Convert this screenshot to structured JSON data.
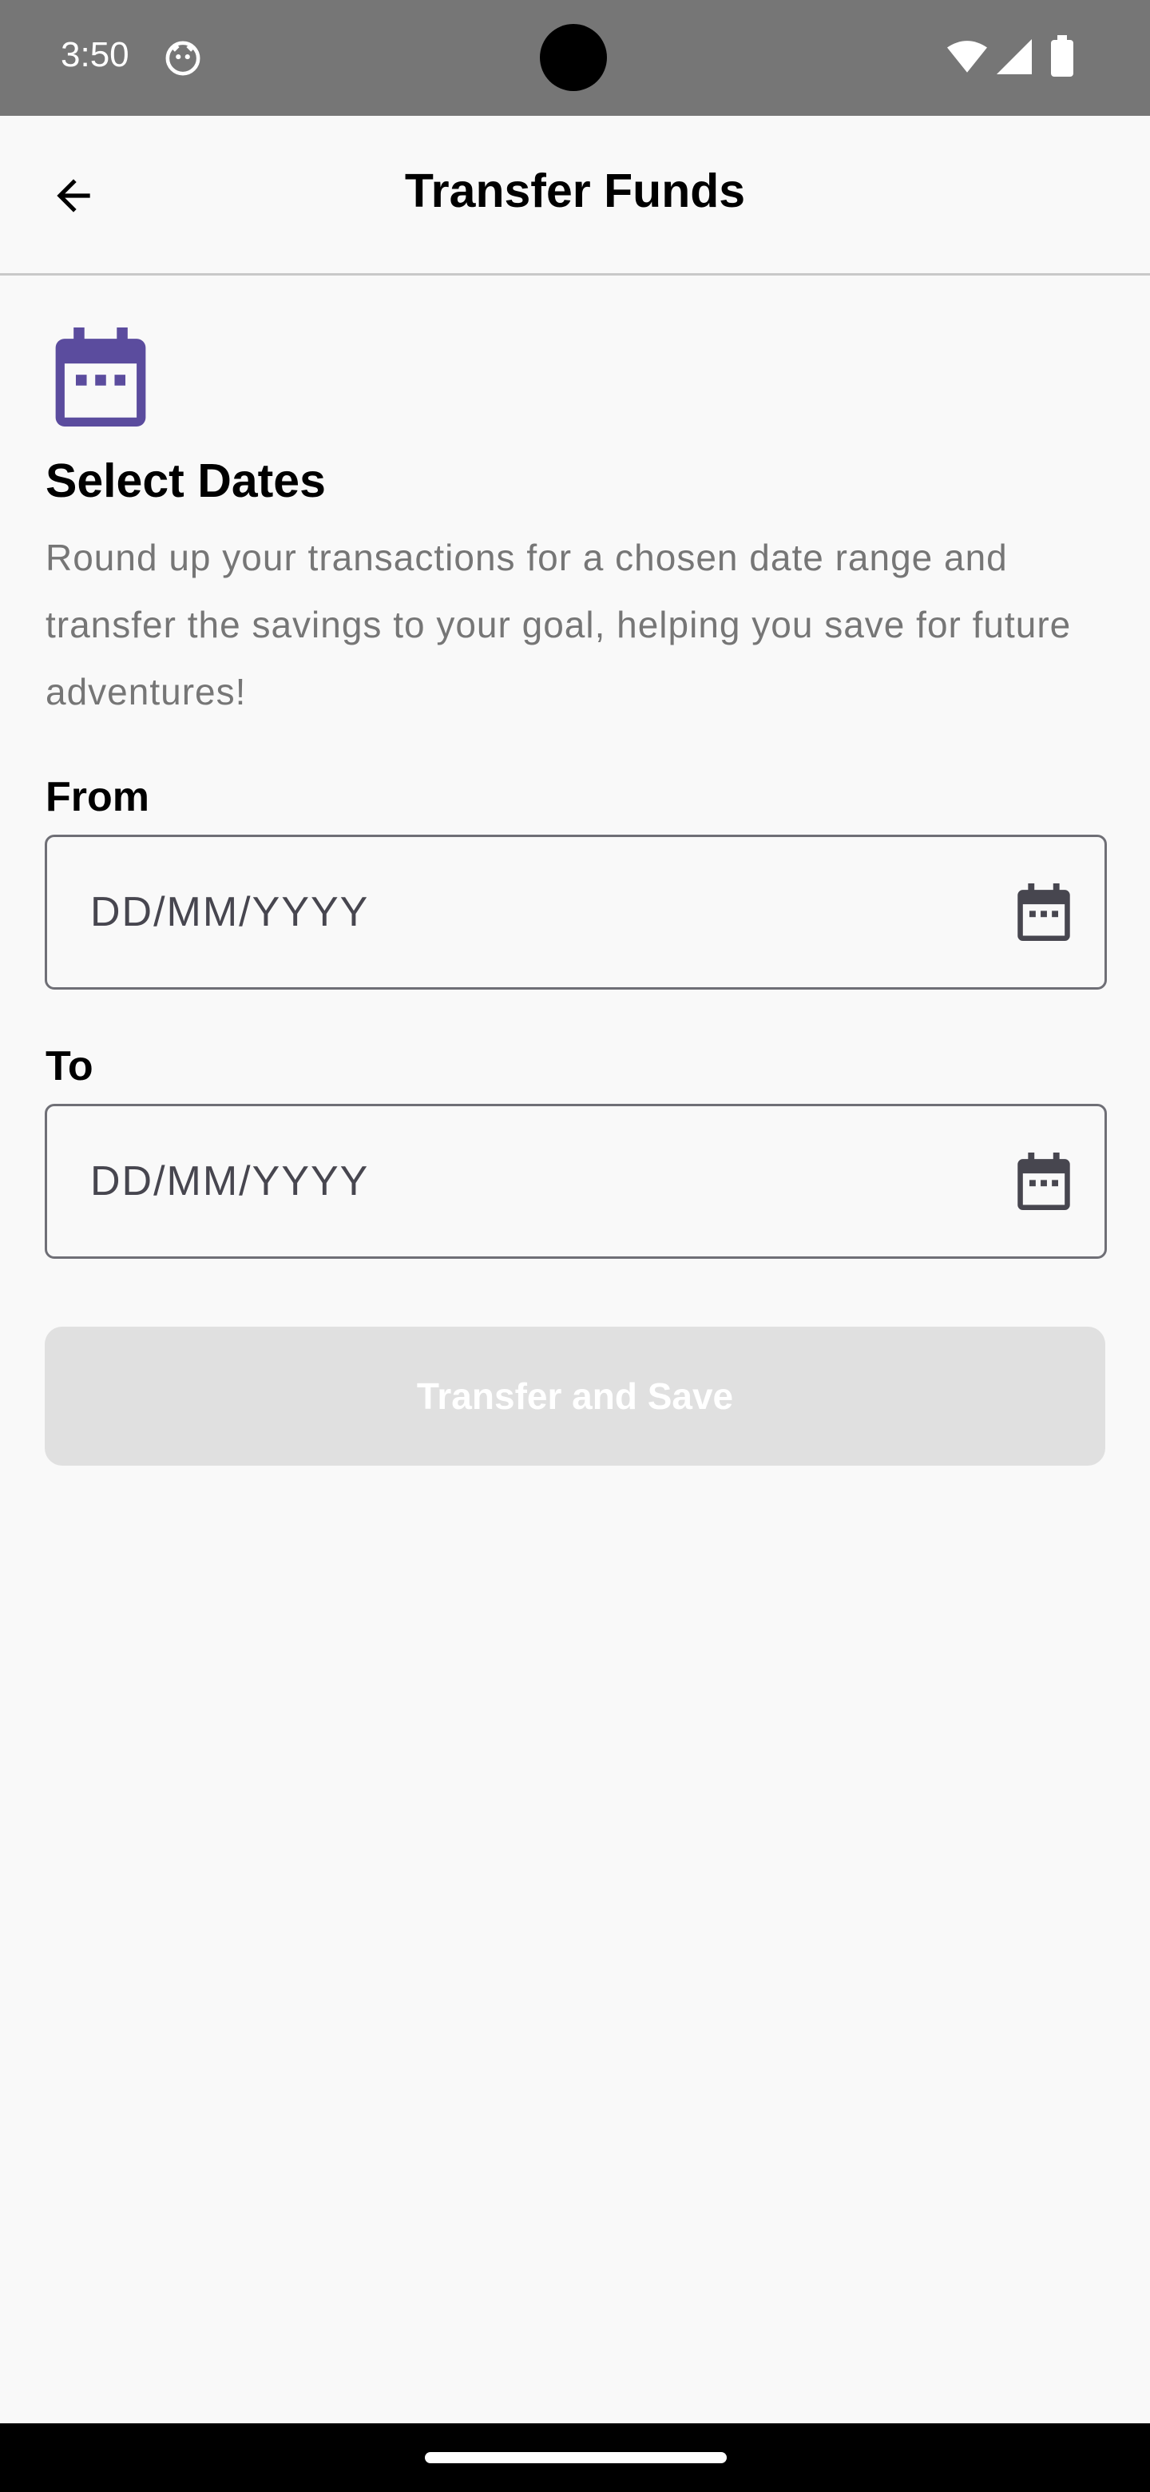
{
  "status_bar": {
    "time": "3:50"
  },
  "app_bar": {
    "title": "Transfer Funds"
  },
  "intro": {
    "title": "Select Dates",
    "description": "Round up your transactions for a chosen date range and transfer the savings to your goal, helping you save for future adventures!"
  },
  "form": {
    "from_label": "From",
    "from_placeholder": "DD/MM/YYYY",
    "from_value": "",
    "to_label": "To",
    "to_placeholder": "DD/MM/YYYY",
    "to_value": "",
    "submit_label": "Transfer and Save",
    "submit_enabled": false
  },
  "colors": {
    "accent": "#5b4c9e",
    "status_bar": "#767676",
    "background": "#f9f9f9",
    "button_disabled": "#e0e0e0",
    "field_border": "#6f6f76",
    "muted_text": "#767676"
  },
  "icons": {
    "back": "arrow-back-icon",
    "hero": "calendar-icon",
    "date_picker": "calendar-icon"
  }
}
